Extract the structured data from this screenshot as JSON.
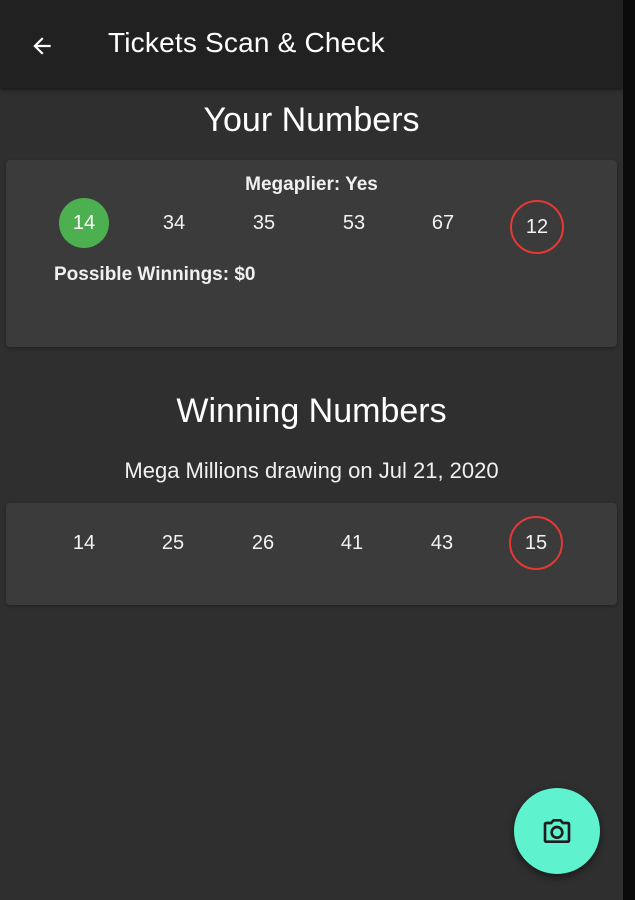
{
  "appbar": {
    "title": "Tickets Scan & Check",
    "back_icon": "arrow-left-icon"
  },
  "your_numbers": {
    "title": "Your Numbers",
    "megaplier": "Megaplier: Yes",
    "balls": [
      {
        "value": "14",
        "state": "match"
      },
      {
        "value": "34",
        "state": "plain"
      },
      {
        "value": "35",
        "state": "plain"
      },
      {
        "value": "53",
        "state": "plain"
      },
      {
        "value": "67",
        "state": "plain"
      },
      {
        "value": "12",
        "state": "mega"
      }
    ],
    "winnings": "Possible Winnings: $0"
  },
  "winning_numbers": {
    "title": "Winning Numbers",
    "drawing": "Mega Millions drawing on Jul 21, 2020",
    "balls": [
      {
        "value": "14",
        "state": "plain"
      },
      {
        "value": "25",
        "state": "plain"
      },
      {
        "value": "26",
        "state": "plain"
      },
      {
        "value": "41",
        "state": "plain"
      },
      {
        "value": "43",
        "state": "plain"
      },
      {
        "value": "15",
        "state": "mega"
      }
    ]
  },
  "fab": {
    "icon": "camera-icon"
  },
  "colors": {
    "match": "#4caf50",
    "mega_ring": "#e53935",
    "fab": "#5ef2cf",
    "card": "#3b3b3b",
    "appbar": "#212121",
    "background": "#2f2f2f"
  }
}
